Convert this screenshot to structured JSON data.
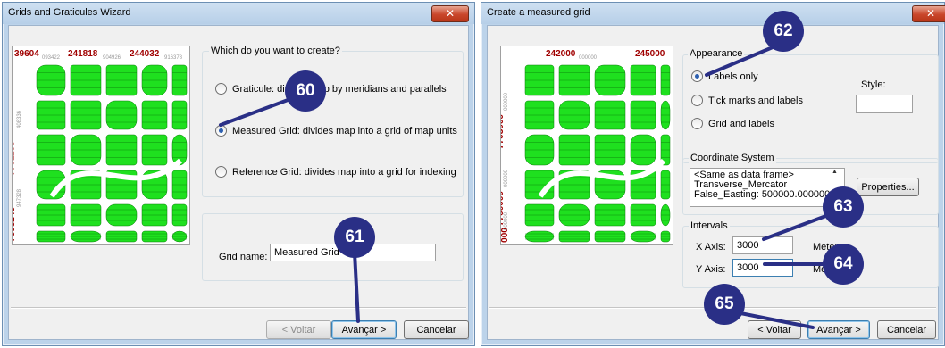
{
  "wizard": {
    "title": "Grids and Graticules Wizard",
    "close": "✕",
    "question": "Which do you want to create?",
    "options": [
      {
        "label": "Graticule: divides map by meridians and parallels",
        "selected": false
      },
      {
        "label": "Measured Grid: divides map into a grid of map units",
        "selected": true
      },
      {
        "label": "Reference Grid: divides map into a grid for indexing",
        "selected": false
      }
    ],
    "grid_name_label": "Grid name:",
    "grid_name_value": "Measured Grid",
    "buttons": {
      "back": "< Voltar",
      "next": "Avançar >",
      "cancel": "Cancelar"
    },
    "preview": {
      "top_labels": [
        "39604",
        "241818",
        "244032"
      ],
      "top_small": [
        "093422",
        "904926",
        "916378"
      ],
      "left_labels": [
        "7701156",
        "7698248"
      ],
      "left_small": [
        "408336",
        "947328"
      ]
    }
  },
  "measured": {
    "title": "Create a measured grid",
    "close": "✕",
    "appearance_label": "Appearance",
    "appearance_options": [
      {
        "label": "Labels only",
        "selected": true
      },
      {
        "label": "Tick marks and labels",
        "selected": false
      },
      {
        "label": "Grid and labels",
        "selected": false
      }
    ],
    "style_label": "Style:",
    "coord_label": "Coordinate System",
    "coord_text": "<Same as data frame>\nTransverse_Mercator\nFalse_Easting: 500000.000000",
    "properties_button": "Properties...",
    "intervals_label": "Intervals",
    "x_label": "X Axis:",
    "x_value": "3000",
    "y_label": "Y Axis:",
    "y_value": "3000",
    "units_x": "Meters",
    "units_y": "Meters",
    "buttons": {
      "back": "< Voltar",
      "next": "Avançar >",
      "cancel": "Cancelar"
    },
    "preview": {
      "top_labels": [
        "242000",
        "245000"
      ],
      "top_small": [
        "000000"
      ],
      "left_labels": [
        "7703000",
        "7700000",
        "000"
      ],
      "left_small": [
        "000000",
        "000000",
        "000000"
      ]
    }
  },
  "callouts": [
    "60",
    "61",
    "62",
    "63",
    "64",
    "65"
  ],
  "colors": {
    "callout": "#2a2f86",
    "map_green": "#1fe01f",
    "coord_red": "#a00000"
  }
}
